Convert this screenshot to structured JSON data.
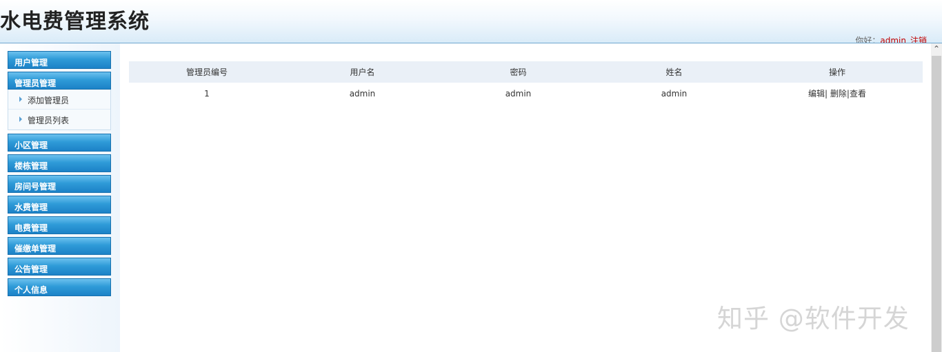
{
  "header": {
    "title": "水电费管理系统",
    "greeting": "你好：",
    "username": "admin",
    "logout": "注销"
  },
  "sidebar": {
    "groups": [
      {
        "label": "用户管理"
      },
      {
        "label": "管理员管理",
        "expanded": true,
        "items": [
          {
            "label": "添加管理员"
          },
          {
            "label": "管理员列表"
          }
        ]
      },
      {
        "label": "小区管理"
      },
      {
        "label": "楼栋管理"
      },
      {
        "label": "房间号管理"
      },
      {
        "label": "水费管理"
      },
      {
        "label": "电费管理"
      },
      {
        "label": "催缴单管理"
      },
      {
        "label": "公告管理"
      },
      {
        "label": "个人信息"
      }
    ]
  },
  "table": {
    "columns": [
      "管理员编号",
      "用户名",
      "密码",
      "姓名",
      "操作"
    ],
    "rows": [
      {
        "id": "1",
        "username": "admin",
        "password": "admin",
        "name": "admin"
      }
    ],
    "actions": {
      "edit": "编辑",
      "sep1": "|",
      "delete": "删除",
      "sep2": "|",
      "view": "查看"
    }
  },
  "watermark": "知乎 @软件开发",
  "colors": {
    "menu_head": "#2f9bd8",
    "header_border": "#6fa6cf",
    "table_header_bg": "#eaf0f7",
    "user_link": "#c00000"
  }
}
